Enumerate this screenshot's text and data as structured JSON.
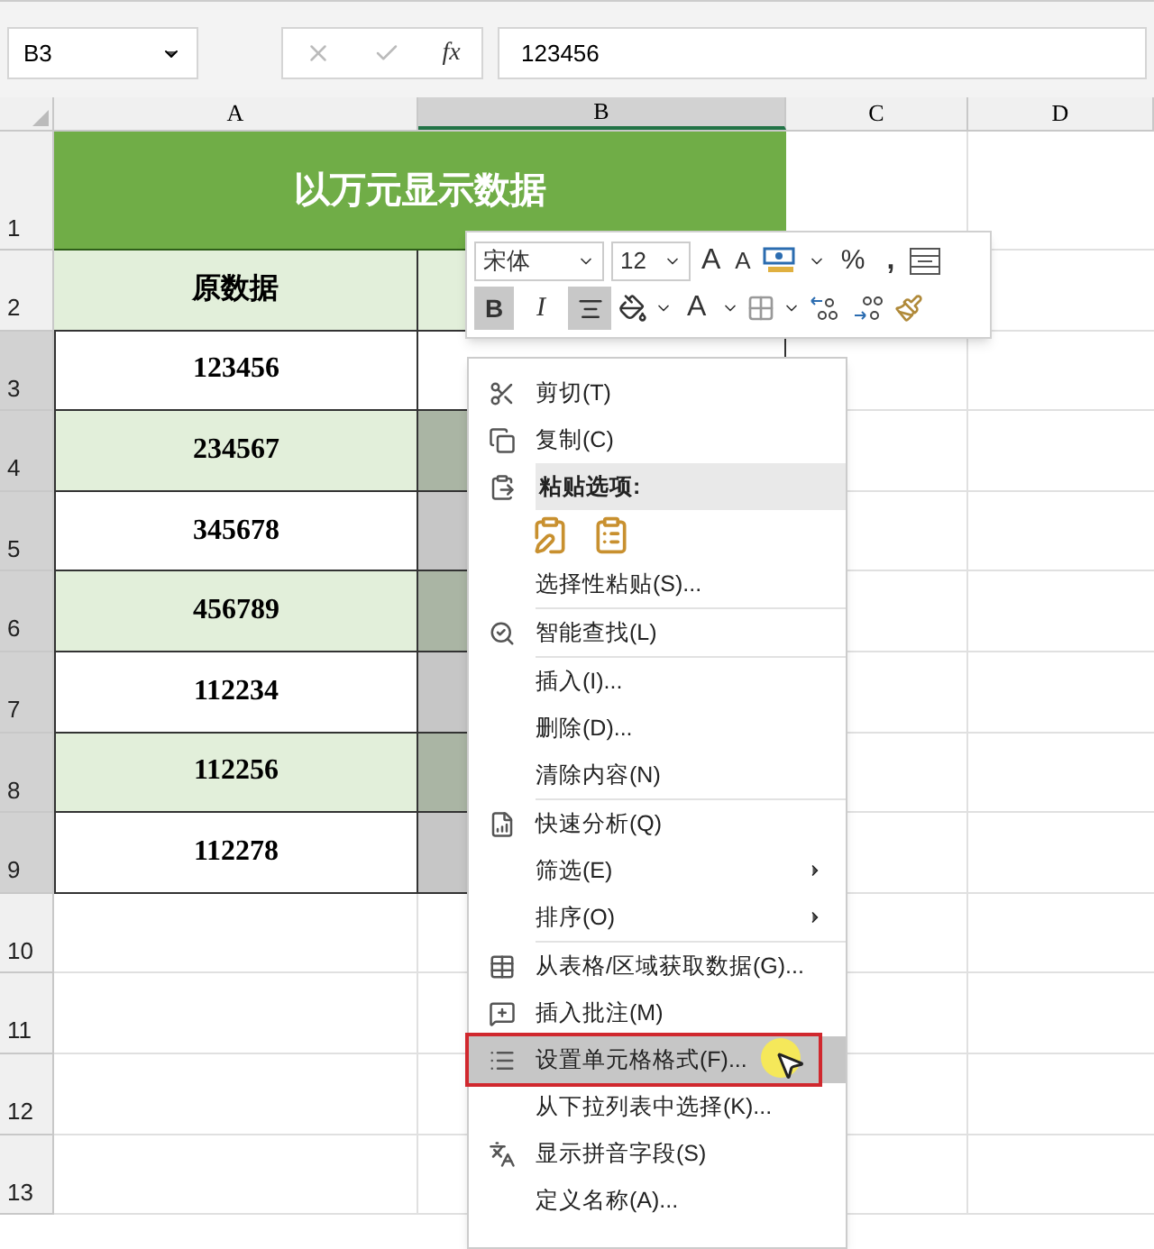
{
  "formula_bar": {
    "name_box": "B3",
    "fx": "fx",
    "value": "123456"
  },
  "columns": [
    {
      "label": "A",
      "selected": false
    },
    {
      "label": "B",
      "selected": true
    },
    {
      "label": "C",
      "selected": false
    },
    {
      "label": "D",
      "selected": false
    }
  ],
  "rows": [
    {
      "label": "1",
      "selected": false
    },
    {
      "label": "2",
      "selected": false
    },
    {
      "label": "3",
      "selected": true
    },
    {
      "label": "4",
      "selected": true
    },
    {
      "label": "5",
      "selected": true
    },
    {
      "label": "6",
      "selected": true
    },
    {
      "label": "7",
      "selected": true
    },
    {
      "label": "8",
      "selected": true
    },
    {
      "label": "9",
      "selected": true
    },
    {
      "label": "10",
      "selected": false
    },
    {
      "label": "11",
      "selected": false
    },
    {
      "label": "12",
      "selected": false
    },
    {
      "label": "13",
      "selected": false
    }
  ],
  "title": "以万元显示数据",
  "header": "原数据",
  "data": [
    {
      "value": "123456",
      "shaded": false,
      "active": true
    },
    {
      "value": "234567",
      "shaded": true,
      "active": false
    },
    {
      "value": "345678",
      "shaded": false,
      "active": false
    },
    {
      "value": "456789",
      "shaded": true,
      "active": false
    },
    {
      "value": "112234",
      "shaded": false,
      "active": false
    },
    {
      "value": "112256",
      "shaded": true,
      "active": false
    },
    {
      "value": "112278",
      "shaded": false,
      "active": false
    }
  ],
  "mini_toolbar": {
    "font": "宋体",
    "size": "12",
    "grow_font": "A",
    "shrink_font": "A",
    "percent": "%",
    "comma": ",",
    "bold": {
      "label": "B",
      "selected": true
    },
    "italic": {
      "label": "I",
      "selected": false
    },
    "center": {
      "selected": true
    },
    "font_color": "A"
  },
  "context_menu": {
    "items": [
      {
        "kind": "item",
        "label": "剪切(T)",
        "selected": false,
        "submenu": false
      },
      {
        "kind": "item",
        "label": "复制(C)",
        "selected": false,
        "submenu": false
      },
      {
        "kind": "header",
        "label": "粘贴选项:"
      },
      {
        "kind": "paste_options"
      },
      {
        "kind": "item",
        "label": "选择性粘贴(S)...",
        "selected": false,
        "submenu": false
      },
      {
        "kind": "separator"
      },
      {
        "kind": "item",
        "label": "智能查找(L)",
        "selected": false,
        "submenu": false
      },
      {
        "kind": "separator"
      },
      {
        "kind": "item",
        "label": "插入(I)...",
        "selected": false,
        "submenu": false
      },
      {
        "kind": "item",
        "label": "删除(D)...",
        "selected": false,
        "submenu": false
      },
      {
        "kind": "item",
        "label": "清除内容(N)",
        "selected": false,
        "submenu": false
      },
      {
        "kind": "separator"
      },
      {
        "kind": "item",
        "label": "快速分析(Q)",
        "selected": false,
        "submenu": false
      },
      {
        "kind": "item",
        "label": "筛选(E)",
        "selected": false,
        "submenu": true
      },
      {
        "kind": "item",
        "label": "排序(O)",
        "selected": false,
        "submenu": true
      },
      {
        "kind": "separator"
      },
      {
        "kind": "item",
        "label": "从表格/区域获取数据(G)...",
        "selected": false,
        "submenu": false
      },
      {
        "kind": "item",
        "label": "插入批注(M)",
        "selected": false,
        "submenu": false
      },
      {
        "kind": "item",
        "label": "设置单元格格式(F)...",
        "selected": true,
        "submenu": false
      },
      {
        "kind": "item",
        "label": "从下拉列表中选择(K)...",
        "selected": false,
        "submenu": false
      },
      {
        "kind": "item",
        "label": "显示拼音字段(S)",
        "selected": false,
        "submenu": false
      },
      {
        "kind": "item",
        "label": "定义名称(A)...",
        "selected": false,
        "submenu": false
      }
    ]
  }
}
